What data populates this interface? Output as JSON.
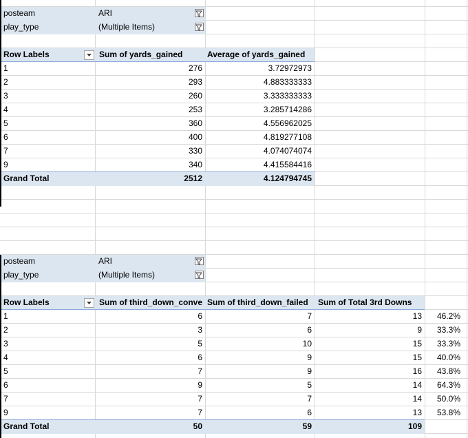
{
  "pivot1": {
    "filters": [
      {
        "field": "posteam",
        "value": "ARI"
      },
      {
        "field": "play_type",
        "value": "(Multiple Items)"
      }
    ],
    "headers": [
      "Row Labels",
      "Sum of yards_gained",
      "Average of yards_gained"
    ],
    "rows": [
      [
        "1",
        "276",
        "3.72972973"
      ],
      [
        "2",
        "293",
        "4.883333333"
      ],
      [
        "3",
        "260",
        "3.333333333"
      ],
      [
        "4",
        "253",
        "3.285714286"
      ],
      [
        "5",
        "360",
        "4.556962025"
      ],
      [
        "6",
        "400",
        "4.819277108"
      ],
      [
        "7",
        "330",
        "4.074074074"
      ],
      [
        "9",
        "340",
        "4.415584416"
      ]
    ],
    "total": [
      "Grand Total",
      "2512",
      "4.124794745"
    ]
  },
  "pivot2": {
    "filters": [
      {
        "field": "posteam",
        "value": "ARI"
      },
      {
        "field": "play_type",
        "value": "(Multiple Items)"
      }
    ],
    "headers": [
      "Row Labels",
      "Sum of third_down_conve",
      "Sum of third_down_failed",
      "Sum of Total 3rd Downs"
    ],
    "rows": [
      [
        "1",
        "6",
        "7",
        "13",
        "46.2%"
      ],
      [
        "2",
        "3",
        "6",
        "9",
        "33.3%"
      ],
      [
        "3",
        "5",
        "10",
        "15",
        "33.3%"
      ],
      [
        "4",
        "6",
        "9",
        "15",
        "40.0%"
      ],
      [
        "5",
        "7",
        "9",
        "16",
        "43.8%"
      ],
      [
        "6",
        "9",
        "5",
        "14",
        "64.3%"
      ],
      [
        "7",
        "7",
        "7",
        "14",
        "50.0%"
      ],
      [
        "9",
        "7",
        "6",
        "13",
        "53.8%"
      ]
    ],
    "total": [
      "Grand Total",
      "50",
      "59",
      "109"
    ]
  },
  "colors": {
    "band": "#dce6f1",
    "grid": "#d9d9d9",
    "header_rule": "#8ea9db"
  },
  "icons": {
    "filter": "funnel-filter-icon",
    "dropdown": "dropdown-arrow-icon"
  }
}
